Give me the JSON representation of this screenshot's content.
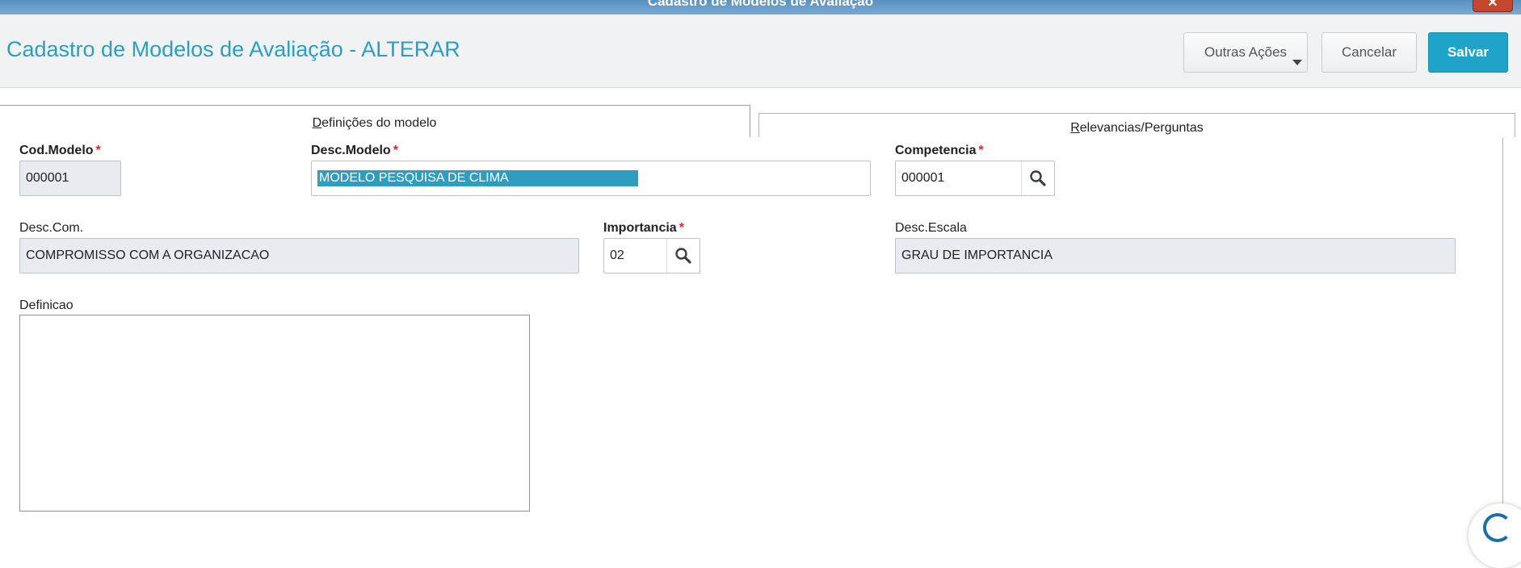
{
  "window": {
    "title": "Cadastro de Modelos de Avaliação",
    "close_glyph": "✕"
  },
  "header": {
    "title": "Cadastro de Modelos de Avaliação - ALTERAR",
    "buttons": {
      "outras_acoes": "Outras Ações",
      "cancelar": "Cancelar",
      "salvar": "Salvar"
    }
  },
  "tabs": {
    "definicoes": {
      "first": "D",
      "rest": "efinições do modelo",
      "active": true
    },
    "relevancias": {
      "first": "R",
      "rest": "elevancias/Perguntas",
      "active": false
    }
  },
  "fields": {
    "cod_modelo": {
      "label": "Cod.Modelo",
      "required_mark": "*",
      "value": "000001",
      "readonly": true
    },
    "desc_modelo": {
      "label": "Desc.Modelo",
      "required_mark": "*",
      "value": "MODELO PESQUISA DE CLIMA",
      "selected": true
    },
    "competencia": {
      "label": "Competencia",
      "required_mark": "*",
      "value": "000001"
    },
    "desc_com": {
      "label": "Desc.Com.",
      "value": "COMPROMISSO COM A ORGANIZACAO",
      "readonly": true
    },
    "importancia": {
      "label": "Importancia",
      "required_mark": "*",
      "value": "02"
    },
    "desc_escala": {
      "label": "Desc.Escala",
      "value": "GRAU DE IMPORTANCIA",
      "readonly": true
    },
    "definicao": {
      "label": "Definicao",
      "value": ""
    }
  },
  "icons": {
    "lookup": "search-icon",
    "dropdown": "caret-down-icon",
    "close": "close-icon",
    "assistant": "help-bubble-icon"
  },
  "colors": {
    "accent": "#2b9ec2",
    "primary_button": "#1fa3c9",
    "required": "#d42a2a",
    "selection": "#2e9dc0",
    "readonly_bg": "#e8ebef"
  }
}
